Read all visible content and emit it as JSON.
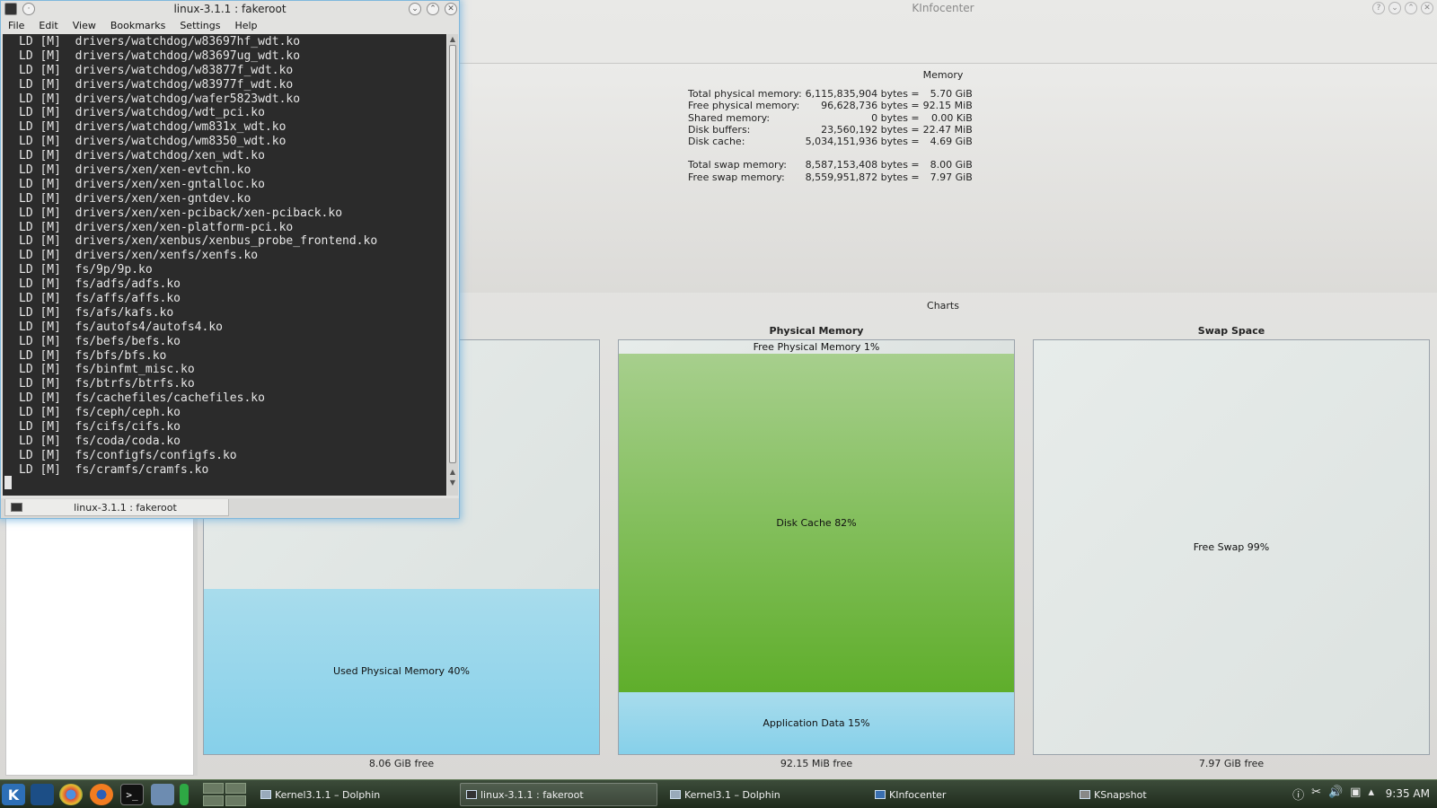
{
  "kinfocenter": {
    "title": "KInfocenter",
    "title_buttons": [
      "?",
      "⌄",
      "⌃",
      "✕"
    ],
    "memory": {
      "heading": "Memory",
      "rows": [
        {
          "label": "Total physical memory:",
          "bytes": "6,115,835,904 bytes =",
          "value": "5.70 GiB"
        },
        {
          "label": "Free physical memory:",
          "bytes": "96,628,736 bytes =",
          "value": "92.15 MiB"
        },
        {
          "label": "Shared memory:",
          "bytes": "0 bytes =",
          "value": "0.00 KiB"
        },
        {
          "label": "Disk buffers:",
          "bytes": "23,560,192 bytes =",
          "value": "22.47 MiB"
        },
        {
          "label": "Disk cache:",
          "bytes": "5,034,151,936 bytes =",
          "value": "4.69 GiB"
        }
      ],
      "swap_rows": [
        {
          "label": "Total swap memory:",
          "bytes": "8,587,153,408 bytes =",
          "value": "8.00 GiB"
        },
        {
          "label": "Free swap memory:",
          "bytes": "8,559,951,872 bytes =",
          "value": "7.97 GiB"
        }
      ]
    },
    "charts": {
      "heading": "Charts",
      "total": {
        "used_label": "Used Physical Memory 40%",
        "used_percent": 40,
        "free": "8.06 GiB free"
      },
      "physical": {
        "title": "Physical Memory",
        "free_label": "Free Physical Memory 1%",
        "free_percent": 1,
        "cache_label": "Disk Cache 82%",
        "cache_percent": 82,
        "app_label": "Application Data 15%",
        "app_percent": 15,
        "free": "92.15 MiB free"
      },
      "swap": {
        "title": "Swap Space",
        "free_label": "Free Swap 99%",
        "free_percent": 99,
        "free": "7.97 GiB free"
      }
    },
    "colors": {
      "used": "#86d0ea",
      "cache": "#5fae2b",
      "free": "#dde3e1"
    }
  },
  "konsole": {
    "title": "linux-3.1.1 : fakeroot",
    "menu": [
      "File",
      "Edit",
      "View",
      "Bookmarks",
      "Settings",
      "Help"
    ],
    "lines": [
      "LD [M]  drivers/watchdog/w83697hf_wdt.ko",
      "LD [M]  drivers/watchdog/w83697ug_wdt.ko",
      "LD [M]  drivers/watchdog/w83877f_wdt.ko",
      "LD [M]  drivers/watchdog/w83977f_wdt.ko",
      "LD [M]  drivers/watchdog/wafer5823wdt.ko",
      "LD [M]  drivers/watchdog/wdt_pci.ko",
      "LD [M]  drivers/watchdog/wm831x_wdt.ko",
      "LD [M]  drivers/watchdog/wm8350_wdt.ko",
      "LD [M]  drivers/watchdog/xen_wdt.ko",
      "LD [M]  drivers/xen/xen-evtchn.ko",
      "LD [M]  drivers/xen/xen-gntalloc.ko",
      "LD [M]  drivers/xen/xen-gntdev.ko",
      "LD [M]  drivers/xen/xen-pciback/xen-pciback.ko",
      "LD [M]  drivers/xen/xen-platform-pci.ko",
      "LD [M]  drivers/xen/xenbus/xenbus_probe_frontend.ko",
      "LD [M]  drivers/xen/xenfs/xenfs.ko",
      "LD [M]  fs/9p/9p.ko",
      "LD [M]  fs/adfs/adfs.ko",
      "LD [M]  fs/affs/affs.ko",
      "LD [M]  fs/afs/kafs.ko",
      "LD [M]  fs/autofs4/autofs4.ko",
      "LD [M]  fs/befs/befs.ko",
      "LD [M]  fs/bfs/bfs.ko",
      "LD [M]  fs/binfmt_misc.ko",
      "LD [M]  fs/btrfs/btrfs.ko",
      "LD [M]  fs/cachefiles/cachefiles.ko",
      "LD [M]  fs/ceph/ceph.ko",
      "LD [M]  fs/cifs/cifs.ko",
      "LD [M]  fs/coda/coda.ko",
      "LD [M]  fs/configfs/configfs.ko",
      "LD [M]  fs/cramfs/cramfs.ko"
    ],
    "tab_label": "linux-3.1.1 : fakeroot"
  },
  "taskbar": {
    "kmenu_glyph": "K",
    "tasks": [
      {
        "label": "Kernel3.1.1 – Dolphin"
      },
      {
        "label": "linux-3.1.1 : fakeroot"
      },
      {
        "label": "Kernel3.1 – Dolphin"
      },
      {
        "label": "KInfocenter"
      },
      {
        "label": "KSnapshot"
      }
    ],
    "clock": "9:35 AM"
  }
}
